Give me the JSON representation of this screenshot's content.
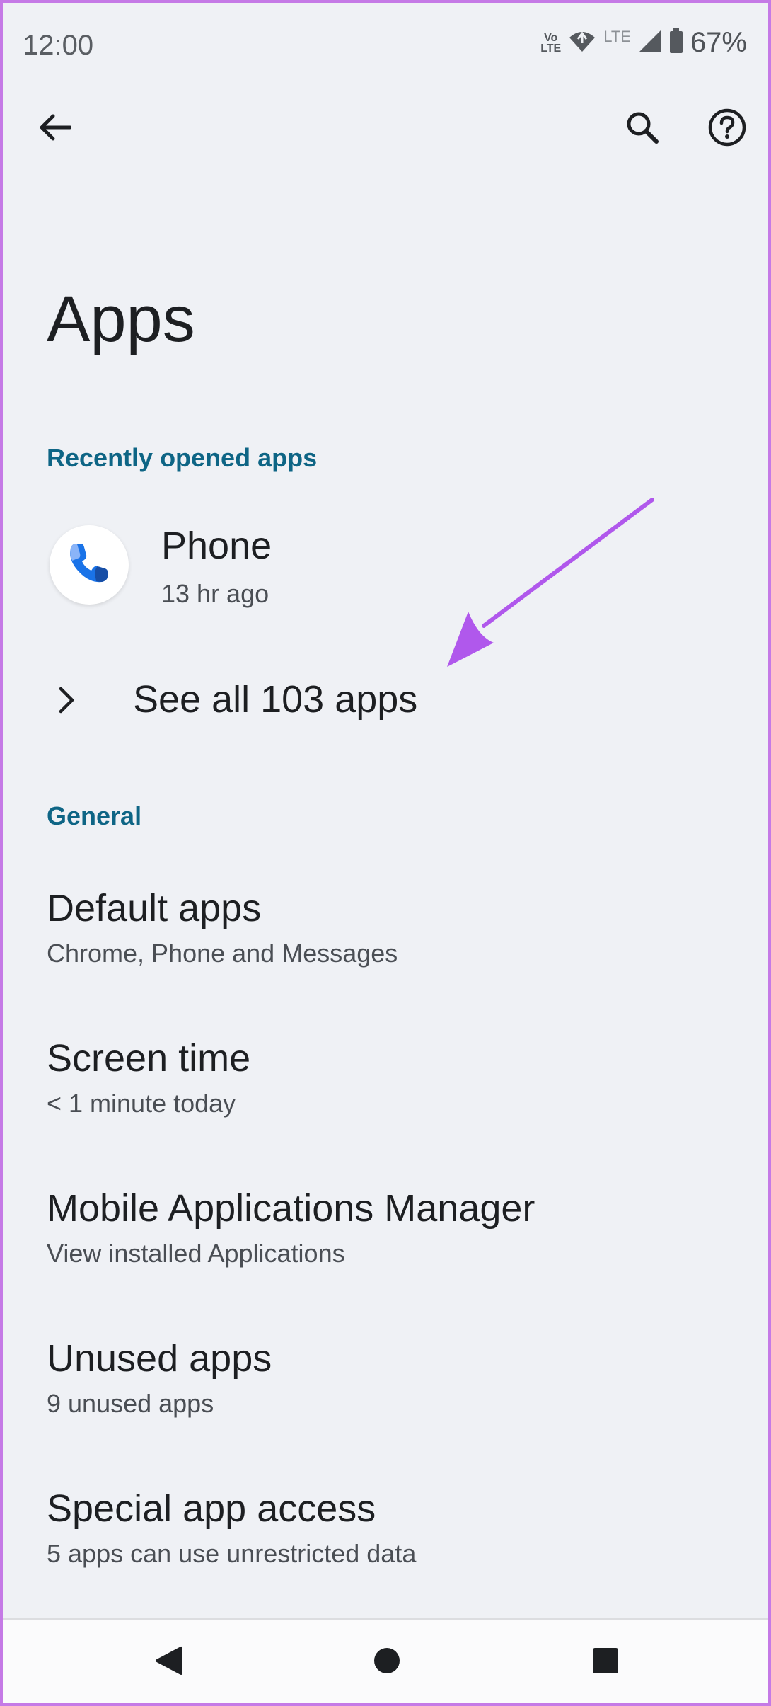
{
  "status_bar": {
    "time": "12:00",
    "volte_label": "Vo\nLTE",
    "lte_label": "LTE",
    "battery_percent": "67%"
  },
  "toolbar": {
    "back_icon": "arrow-left-icon",
    "search_icon": "search-icon",
    "help_icon": "help-icon"
  },
  "page": {
    "title": "Apps"
  },
  "recent": {
    "header": "Recently opened apps",
    "app": {
      "name": "Phone",
      "last_used": "13 hr ago",
      "icon": "phone-icon"
    },
    "see_all_label": "See all 103 apps"
  },
  "general": {
    "header": "General",
    "items": [
      {
        "title": "Default apps",
        "subtitle": "Chrome, Phone and Messages"
      },
      {
        "title": "Screen time",
        "subtitle": "< 1 minute today"
      },
      {
        "title": "Mobile Applications Manager",
        "subtitle": "View installed Applications"
      },
      {
        "title": "Unused apps",
        "subtitle": "9 unused apps"
      },
      {
        "title": "Special app access",
        "subtitle": "5 apps can use unrestricted data"
      }
    ]
  },
  "colors": {
    "background": "#eff1f5",
    "section_header": "#0e6585",
    "annotation_arrow": "#b058ec",
    "frame": "#c57ae6"
  }
}
